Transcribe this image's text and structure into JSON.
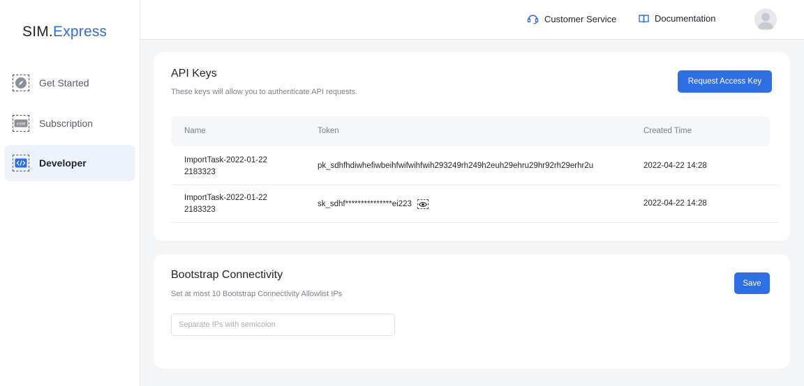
{
  "brand": {
    "part1": "SIM.",
    "part2": "Express"
  },
  "sidebar": {
    "items": [
      {
        "label": "Get Started",
        "icon": "compass-icon"
      },
      {
        "label": "Subscription",
        "icon": "esim-icon",
        "icon_text": "eSIM"
      },
      {
        "label": "Developer",
        "icon": "code-icon",
        "active": true
      }
    ]
  },
  "header": {
    "customer_service": "Customer Service",
    "documentation": "Documentation"
  },
  "api_keys": {
    "title": "API Keys",
    "subtitle": "These keys will allow you to authenticate API requests.",
    "request_button": "Request Access Key",
    "columns": [
      "Name",
      "Token",
      "Created Time"
    ],
    "rows": [
      {
        "name": "ImportTask-2022-01-22 2183323",
        "token": "pk_sdhfhdiwhefiwbeihfwifwihfwih293249rh249h2euh29ehru29hr92rh29erhr2u",
        "created": "2022-04-22 14:28",
        "masked": false
      },
      {
        "name": "ImportTask-2022-01-22 2183323",
        "token": "sk_sdhf***************ei223",
        "created": "2022-04-22 14:28",
        "masked": true
      }
    ]
  },
  "bootstrap": {
    "title": "Bootstrap Connectivity",
    "subtitle": "Set at most 10 Bootstrap Connectivity Allowlist IPs",
    "save_button": "Save",
    "ip_input": {
      "value": "",
      "placeholder": "Separate IPs with semicolon"
    }
  },
  "colors": {
    "accent": "#2f6fe4",
    "brand_blue": "#2d6cdf",
    "active_bg": "#eef2fb",
    "page_bg": "#f4f5f7"
  }
}
